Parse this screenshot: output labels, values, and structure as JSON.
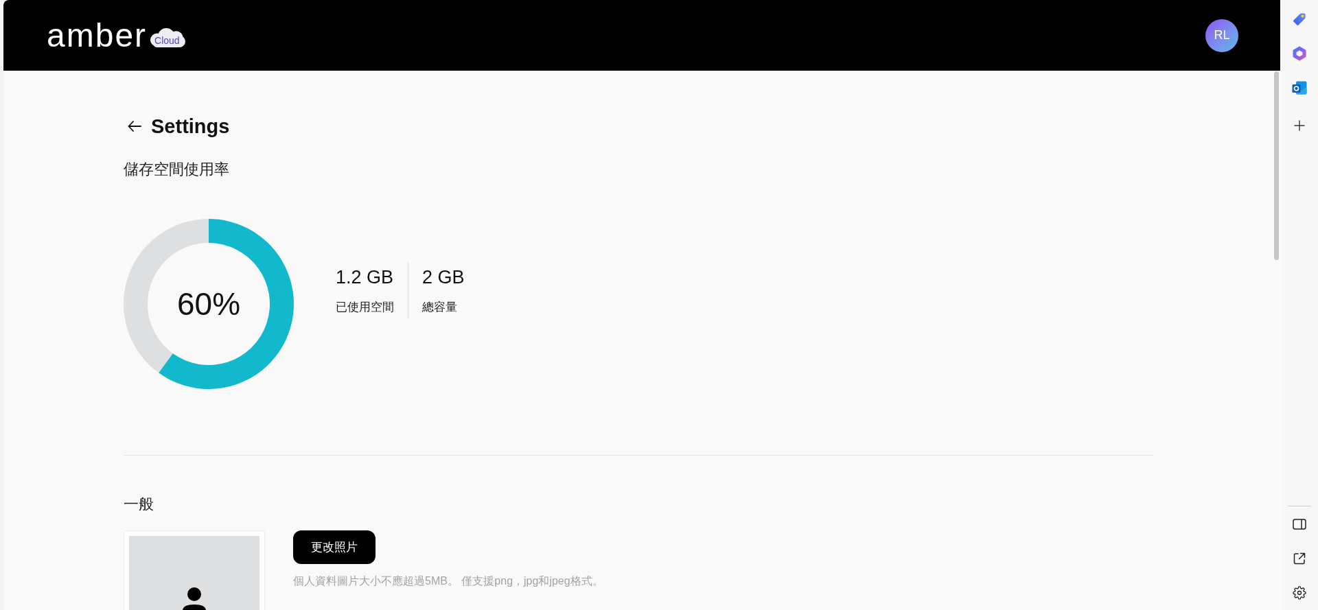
{
  "header": {
    "logo": {
      "wordmark": "amber",
      "badge": "Cloud"
    },
    "avatar": {
      "initials": "RL"
    }
  },
  "page": {
    "title": "Settings"
  },
  "storage": {
    "heading": "儲存空間使用率",
    "usage_chart": {
      "chart_data": {
        "type": "donut",
        "values": [
          60,
          40
        ]
      },
      "center_label": "60%"
    },
    "stats": [
      {
        "value": "1.2 GB",
        "label": "已使用空間"
      },
      {
        "value": "2 GB",
        "label": "總容量"
      }
    ]
  },
  "general": {
    "heading": "一般",
    "profile_photo": {
      "change_button": "更改照片",
      "hint": "個人資料圖片大小不應超過5MB。 僅支援png，jpg和jpeg格式。"
    }
  }
}
